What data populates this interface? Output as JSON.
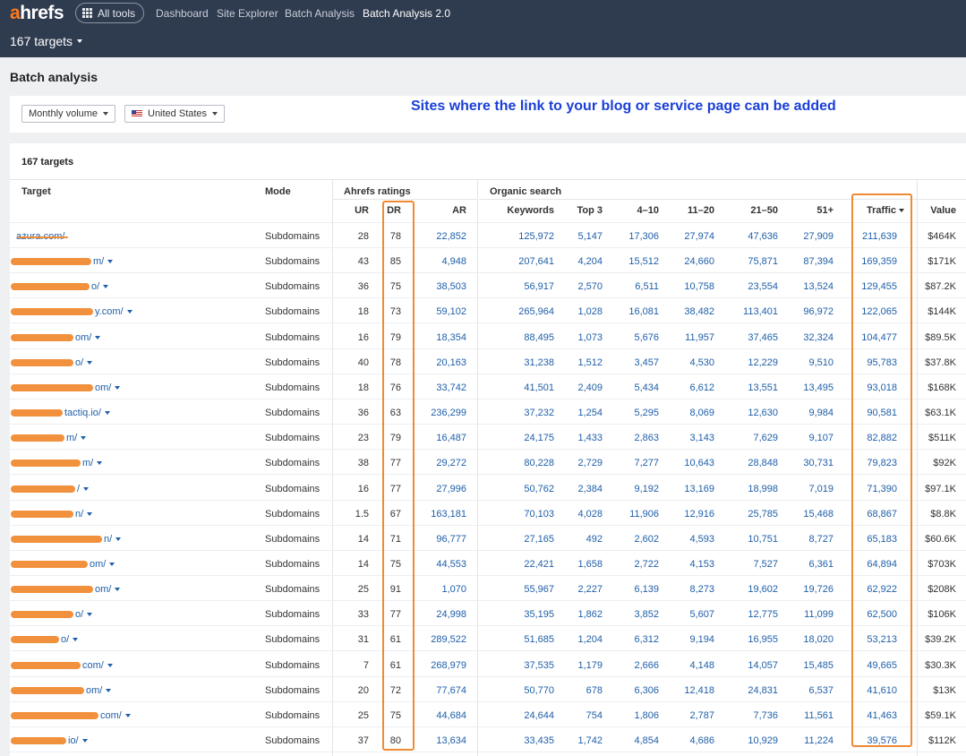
{
  "nav": {
    "logo_accent": "a",
    "logo_rest": "hrefs",
    "all_tools": "All tools",
    "links": [
      "Dashboard",
      "Site Explorer",
      "Batch Analysis",
      "Batch Analysis 2.0"
    ],
    "targets_dropdown": "167 targets"
  },
  "page_title": "Batch analysis",
  "filters": {
    "volume": "Monthly volume",
    "country": "United States"
  },
  "annotation": "Sites where the link to your blog or service page can be added",
  "panel_title": "167 targets",
  "headers": {
    "target": "Target",
    "mode": "Mode",
    "ahrefs_ratings": "Ahrefs ratings",
    "organic_search": "Organic search",
    "ur": "UR",
    "dr": "DR",
    "ar": "AR",
    "keywords": "Keywords",
    "top3": "Top 3",
    "p4_10": "4–10",
    "p11_20": "11–20",
    "p21_50": "21–50",
    "p51": "51+",
    "traffic": "Traffic",
    "value": "Value"
  },
  "colors": {
    "topbar": "#2f3b4f",
    "link": "#1f5fa8",
    "annotation": "#1a3fd8",
    "highlight": "#f08a33"
  },
  "rows": [
    {
      "target": "azura.com/",
      "mode": "Subdomains",
      "ur": "28",
      "dr": "78",
      "ar": "22,852",
      "keywords": "125,972",
      "top3": "5,147",
      "p4_10": "17,306",
      "p11_20": "27,974",
      "p21_50": "47,636",
      "p51": "27,909",
      "traffic": "211,639",
      "value": "$464K"
    },
    {
      "target": "m/",
      "mode": "Subdomains",
      "ur": "43",
      "dr": "85",
      "ar": "4,948",
      "keywords": "207,641",
      "top3": "4,204",
      "p4_10": "15,512",
      "p11_20": "24,660",
      "p21_50": "75,871",
      "p51": "87,394",
      "traffic": "169,359",
      "value": "$171K"
    },
    {
      "target": "o/",
      "mode": "Subdomains",
      "ur": "36",
      "dr": "75",
      "ar": "38,503",
      "keywords": "56,917",
      "top3": "2,570",
      "p4_10": "6,511",
      "p11_20": "10,758",
      "p21_50": "23,554",
      "p51": "13,524",
      "traffic": "129,455",
      "value": "$87.2K"
    },
    {
      "target": "y.com/",
      "mode": "Subdomains",
      "ur": "18",
      "dr": "73",
      "ar": "59,102",
      "keywords": "265,964",
      "top3": "1,028",
      "p4_10": "16,081",
      "p11_20": "38,482",
      "p21_50": "113,401",
      "p51": "96,972",
      "traffic": "122,065",
      "value": "$144K"
    },
    {
      "target": "om/",
      "mode": "Subdomains",
      "ur": "16",
      "dr": "79",
      "ar": "18,354",
      "keywords": "88,495",
      "top3": "1,073",
      "p4_10": "5,676",
      "p11_20": "11,957",
      "p21_50": "37,465",
      "p51": "32,324",
      "traffic": "104,477",
      "value": "$89.5K"
    },
    {
      "target": "o/",
      "mode": "Subdomains",
      "ur": "40",
      "dr": "78",
      "ar": "20,163",
      "keywords": "31,238",
      "top3": "1,512",
      "p4_10": "3,457",
      "p11_20": "4,530",
      "p21_50": "12,229",
      "p51": "9,510",
      "traffic": "95,783",
      "value": "$37.8K"
    },
    {
      "target": "om/",
      "mode": "Subdomains",
      "ur": "18",
      "dr": "76",
      "ar": "33,742",
      "keywords": "41,501",
      "top3": "2,409",
      "p4_10": "5,434",
      "p11_20": "6,612",
      "p21_50": "13,551",
      "p51": "13,495",
      "traffic": "93,018",
      "value": "$168K"
    },
    {
      "target": "tactiq.io/",
      "mode": "Subdomains",
      "ur": "36",
      "dr": "63",
      "ar": "236,299",
      "keywords": "37,232",
      "top3": "1,254",
      "p4_10": "5,295",
      "p11_20": "8,069",
      "p21_50": "12,630",
      "p51": "9,984",
      "traffic": "90,581",
      "value": "$63.1K"
    },
    {
      "target": "m/",
      "mode": "Subdomains",
      "ur": "23",
      "dr": "79",
      "ar": "16,487",
      "keywords": "24,175",
      "top3": "1,433",
      "p4_10": "2,863",
      "p11_20": "3,143",
      "p21_50": "7,629",
      "p51": "9,107",
      "traffic": "82,882",
      "value": "$511K"
    },
    {
      "target": "m/",
      "mode": "Subdomains",
      "ur": "38",
      "dr": "77",
      "ar": "29,272",
      "keywords": "80,228",
      "top3": "2,729",
      "p4_10": "7,277",
      "p11_20": "10,643",
      "p21_50": "28,848",
      "p51": "30,731",
      "traffic": "79,823",
      "value": "$92K"
    },
    {
      "target": "/",
      "mode": "Subdomains",
      "ur": "16",
      "dr": "77",
      "ar": "27,996",
      "keywords": "50,762",
      "top3": "2,384",
      "p4_10": "9,192",
      "p11_20": "13,169",
      "p21_50": "18,998",
      "p51": "7,019",
      "traffic": "71,390",
      "value": "$97.1K"
    },
    {
      "target": "n/",
      "mode": "Subdomains",
      "ur": "1.5",
      "dr": "67",
      "ar": "163,181",
      "keywords": "70,103",
      "top3": "4,028",
      "p4_10": "11,906",
      "p11_20": "12,916",
      "p21_50": "25,785",
      "p51": "15,468",
      "traffic": "68,867",
      "value": "$8.8K"
    },
    {
      "target": "n/",
      "mode": "Subdomains",
      "ur": "14",
      "dr": "71",
      "ar": "96,777",
      "keywords": "27,165",
      "top3": "492",
      "p4_10": "2,602",
      "p11_20": "4,593",
      "p21_50": "10,751",
      "p51": "8,727",
      "traffic": "65,183",
      "value": "$60.6K"
    },
    {
      "target": "om/",
      "mode": "Subdomains",
      "ur": "14",
      "dr": "75",
      "ar": "44,553",
      "keywords": "22,421",
      "top3": "1,658",
      "p4_10": "2,722",
      "p11_20": "4,153",
      "p21_50": "7,527",
      "p51": "6,361",
      "traffic": "64,894",
      "value": "$703K"
    },
    {
      "target": "om/",
      "mode": "Subdomains",
      "ur": "25",
      "dr": "91",
      "ar": "1,070",
      "keywords": "55,967",
      "top3": "2,227",
      "p4_10": "6,139",
      "p11_20": "8,273",
      "p21_50": "19,602",
      "p51": "19,726",
      "traffic": "62,922",
      "value": "$208K"
    },
    {
      "target": "o/",
      "mode": "Subdomains",
      "ur": "33",
      "dr": "77",
      "ar": "24,998",
      "keywords": "35,195",
      "top3": "1,862",
      "p4_10": "3,852",
      "p11_20": "5,607",
      "p21_50": "12,775",
      "p51": "11,099",
      "traffic": "62,500",
      "value": "$106K"
    },
    {
      "target": "o/",
      "mode": "Subdomains",
      "ur": "31",
      "dr": "61",
      "ar": "289,522",
      "keywords": "51,685",
      "top3": "1,204",
      "p4_10": "6,312",
      "p11_20": "9,194",
      "p21_50": "16,955",
      "p51": "18,020",
      "traffic": "53,213",
      "value": "$39.2K"
    },
    {
      "target": "com/",
      "mode": "Subdomains",
      "ur": "7",
      "dr": "61",
      "ar": "268,979",
      "keywords": "37,535",
      "top3": "1,179",
      "p4_10": "2,666",
      "p11_20": "4,148",
      "p21_50": "14,057",
      "p51": "15,485",
      "traffic": "49,665",
      "value": "$30.3K"
    },
    {
      "target": "om/",
      "mode": "Subdomains",
      "ur": "20",
      "dr": "72",
      "ar": "77,674",
      "keywords": "50,770",
      "top3": "678",
      "p4_10": "6,306",
      "p11_20": "12,418",
      "p21_50": "24,831",
      "p51": "6,537",
      "traffic": "41,610",
      "value": "$13K"
    },
    {
      "target": "com/",
      "mode": "Subdomains",
      "ur": "25",
      "dr": "75",
      "ar": "44,684",
      "keywords": "24,644",
      "top3": "754",
      "p4_10": "1,806",
      "p11_20": "2,787",
      "p21_50": "7,736",
      "p51": "11,561",
      "traffic": "41,463",
      "value": "$59.1K"
    },
    {
      "target": "io/",
      "mode": "Subdomains",
      "ur": "37",
      "dr": "80",
      "ar": "13,634",
      "keywords": "33,435",
      "top3": "1,742",
      "p4_10": "4,854",
      "p11_20": "4,686",
      "p21_50": "10,929",
      "p51": "11,224",
      "traffic": "39,576",
      "value": "$112K"
    }
  ]
}
